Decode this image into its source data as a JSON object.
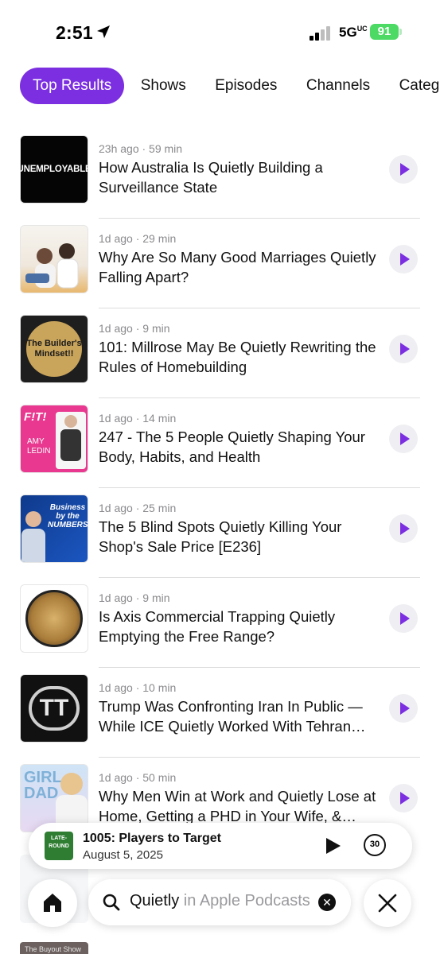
{
  "status_bar": {
    "time": "2:51",
    "network": "5G",
    "network_suffix": "UC",
    "battery": "91"
  },
  "tabs": [
    {
      "label": "Top Results",
      "active": true
    },
    {
      "label": "Shows"
    },
    {
      "label": "Episodes"
    },
    {
      "label": "Channels"
    },
    {
      "label": "Catego"
    }
  ],
  "episodes": [
    {
      "meta": "23h ago · 59 min",
      "title": "How Australia Is Quietly Building a Surveillance State",
      "art_text": "UNEMPLOYABLE"
    },
    {
      "meta": "1d ago · 29 min",
      "title": "Why Are So Many Good Marriages Quietly Falling Apart?",
      "art_text": ""
    },
    {
      "meta": "1d ago · 9 min",
      "title": "101: Millrose May Be Quietly Rewriting the Rules of Homebuilding",
      "art_text": "The Builder's Mindset!!"
    },
    {
      "meta": "1d ago · 14 min",
      "title": "247 - The 5 People Quietly Shaping Your Body, Habits, and Health",
      "art_text": "F!T!"
    },
    {
      "meta": "1d ago · 25 min",
      "title": "The 5 Blind Spots Quietly Killing Your Shop's Sale Price [E236]",
      "art_text": "Business by the NUMBERS"
    },
    {
      "meta": "1d ago · 9 min",
      "title": "Is Axis Commercial Trapping Quietly Emptying the Free Range?",
      "art_text": ""
    },
    {
      "meta": "1d ago · 10 min",
      "title": "Trump Was Confronting Iran In Public — While ICE Quietly Worked With Tehran…",
      "art_text": "TT"
    },
    {
      "meta": "1d ago · 50 min",
      "title": "Why Men Win at Work and Quietly Lose at Home, Getting a PHD in Your Wife, &…",
      "art_text": "GIRL DAD"
    }
  ],
  "now_playing": {
    "title": "1005: Players to Target",
    "date": "August 5, 2025",
    "skip_seconds": "30"
  },
  "search": {
    "query": "Quietly",
    "scope": " in Apple Podcasts"
  },
  "ghost": {
    "label": "The Buyout Show"
  },
  "colors": {
    "accent": "#7b2fe0",
    "battery": "#4cd964"
  },
  "icons": [
    "location-arrow-icon",
    "signal-icon",
    "play-icon",
    "skip-forward-30-icon",
    "home-icon",
    "search-icon",
    "clear-icon",
    "close-icon"
  ]
}
